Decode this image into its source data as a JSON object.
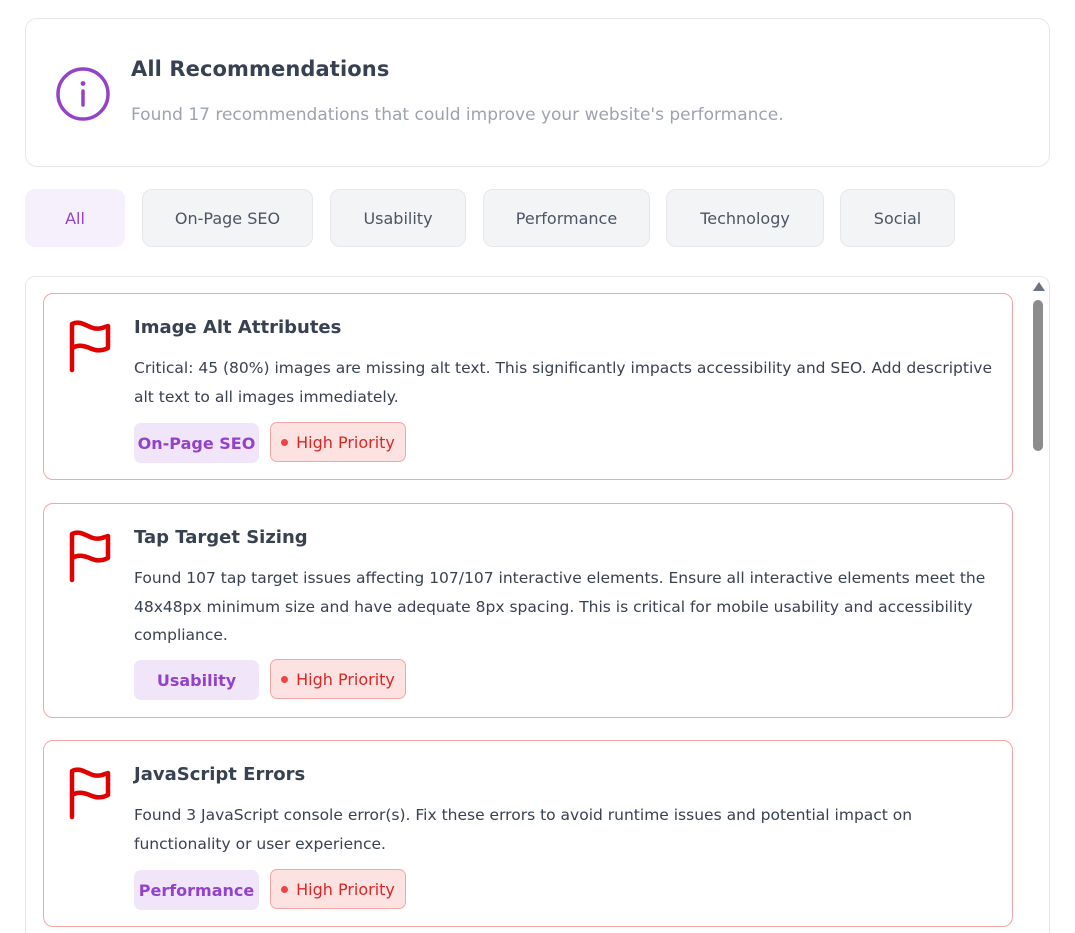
{
  "summary": {
    "title": "All Recommendations",
    "subtitle": "Found 17 recommendations that could improve your website's performance.",
    "icon": "info-circle-icon",
    "accent": "#9343c9"
  },
  "tabs": [
    {
      "label": "All",
      "active": true
    },
    {
      "label": "On-Page SEO",
      "active": false
    },
    {
      "label": "Usability",
      "active": false
    },
    {
      "label": "Performance",
      "active": false
    },
    {
      "label": "Technology",
      "active": false
    },
    {
      "label": "Social",
      "active": false
    }
  ],
  "recommendations": [
    {
      "title": "Image Alt Attributes",
      "description": "Critical: 45 (80%) images are missing alt text. This significantly impacts accessibility and SEO. Add descriptive alt text to all images immediately.",
      "category": "On-Page SEO",
      "priority": "High Priority",
      "icon": "flag-icon"
    },
    {
      "title": "Tap Target Sizing",
      "description": "Found 107 tap target issues affecting 107/107 interactive elements. Ensure all interactive elements meet the 48x48px minimum size and have adequate 8px spacing. This is critical for mobile usability and accessibility compliance.",
      "category": "Usability",
      "priority": "High Priority",
      "icon": "flag-icon"
    },
    {
      "title": "JavaScript Errors",
      "description": "Found 3 JavaScript console error(s). Fix these errors to avoid runtime issues and potential impact on functionality or user experience.",
      "category": "Performance",
      "priority": "High Priority",
      "icon": "flag-icon"
    }
  ],
  "colors": {
    "flag": "#e00000",
    "priority_text": "#dc2626",
    "category_bg": "#f1e5f9"
  }
}
